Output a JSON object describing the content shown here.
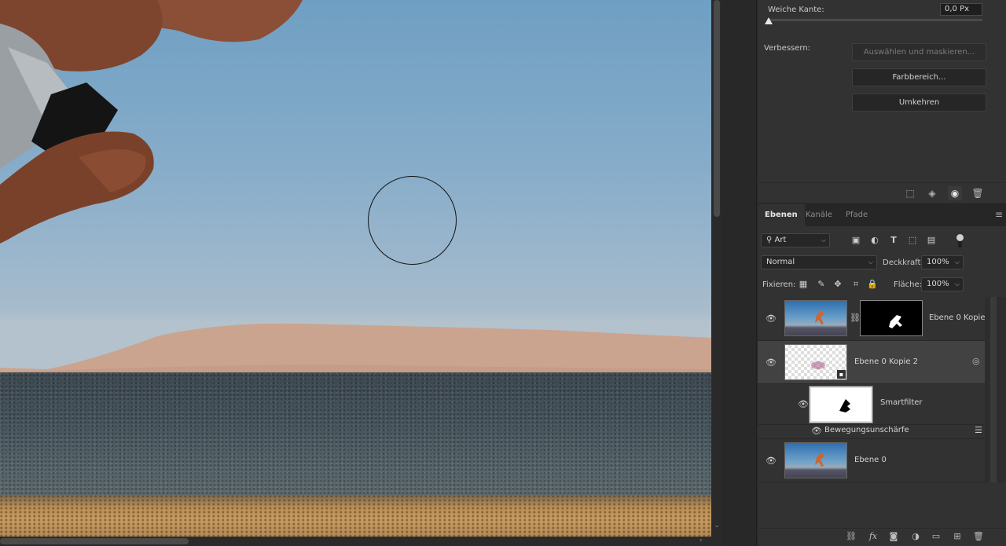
{
  "canvas": {
    "description_icon": "brush-cursor"
  },
  "properties": {
    "feather_label": "Weiche Kante:",
    "feather_value": "0,0 Px",
    "refine_label": "Verbessern:",
    "select_and_mask_label": "Auswählen und maskieren...",
    "color_range_label": "Farbbereich...",
    "invert_label": "Umkehren",
    "footer_icons": [
      "selection-icon",
      "apply-mask-icon",
      "visibility-icon",
      "delete-icon"
    ]
  },
  "layers_panel": {
    "tabs": [
      {
        "label": "Ebenen",
        "active": true
      },
      {
        "label": "Kanäle",
        "active": false
      },
      {
        "label": "Pfade",
        "active": false
      }
    ],
    "filter_kind": "Art",
    "blend_mode": "Normal",
    "opacity_label": "Deckkraft:",
    "opacity_value": "100%",
    "lock_label": "Fixieren:",
    "fill_label": "Fläche:",
    "fill_value": "100%",
    "layers": [
      {
        "name": "Ebene 0 Kopie",
        "visible": true,
        "has_mask": true
      },
      {
        "name": "Ebene 0 Kopie 2",
        "visible": true,
        "smart_object": true,
        "selected": true
      },
      {
        "name": "Smartfilter",
        "visible": true,
        "type": "smart-filter"
      },
      {
        "name": "Bewegungsunschärfe",
        "visible": true,
        "type": "filter"
      },
      {
        "name": "Ebene 0",
        "visible": true
      }
    ],
    "footer_icons": [
      "link-icon",
      "fx-icon",
      "add-mask-icon",
      "adjustment-icon",
      "group-icon",
      "new-layer-icon",
      "trash-icon"
    ],
    "fx_label": "fx"
  },
  "colors": {
    "panel_bg": "#323232",
    "dark_bg": "#282828",
    "selected_row": "#424242"
  }
}
